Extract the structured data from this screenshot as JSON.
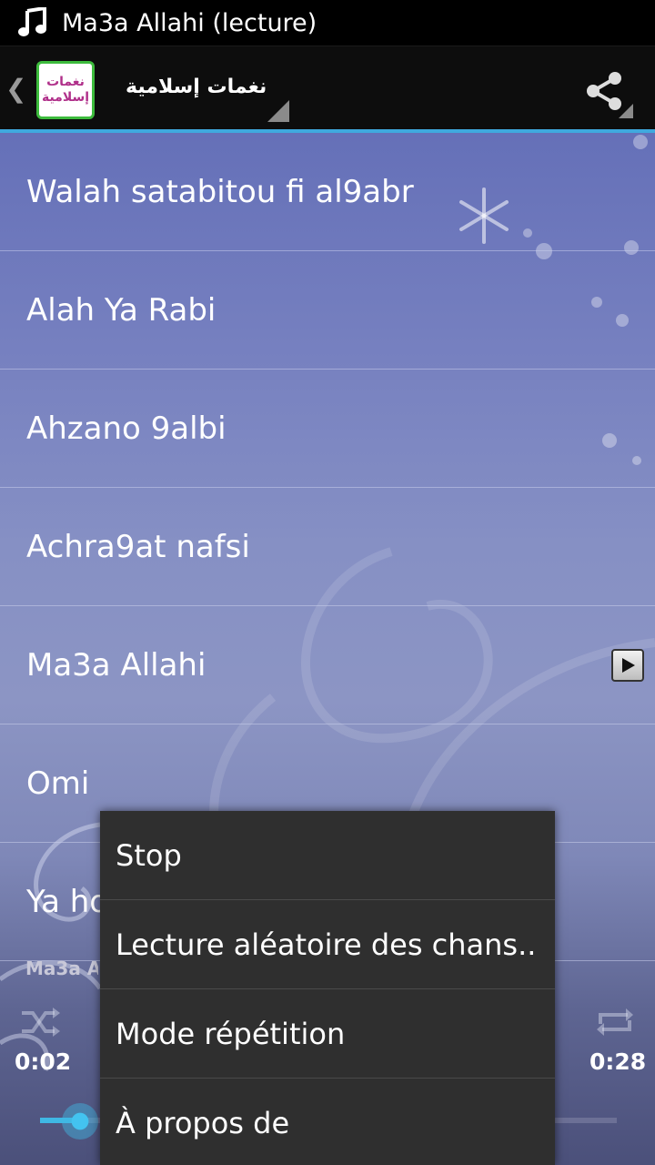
{
  "status_bar": {
    "title": "Ma3a Allahi (lecture)",
    "icon": "music-note-icon"
  },
  "action_bar": {
    "app_logo_line1": "نغمات",
    "app_logo_line2": "إسلامية",
    "app_title": "نغمات إسلامية",
    "icons": [
      "up-chevron-icon",
      "share-icon"
    ],
    "accent_color": "#3fa9de"
  },
  "songs": [
    {
      "title": "Walah satabitou fi al9abr"
    },
    {
      "title": "Alah Ya Rabi"
    },
    {
      "title": "Ahzano 9albi"
    },
    {
      "title": "Achra9at nafsi"
    },
    {
      "title": "Ma3a Allahi",
      "playing": true
    },
    {
      "title": "Omi"
    },
    {
      "title": "Ya ho"
    }
  ],
  "player": {
    "now_playing": "Ma3a A",
    "time_elapsed": "0:02",
    "time_total": "0:28",
    "progress_fraction": 0.07
  },
  "menu": {
    "items": [
      {
        "label": "Stop"
      },
      {
        "label": "Lecture aléatoire des chans.."
      },
      {
        "label": "Mode répétition"
      },
      {
        "label": "À propos de"
      }
    ]
  }
}
